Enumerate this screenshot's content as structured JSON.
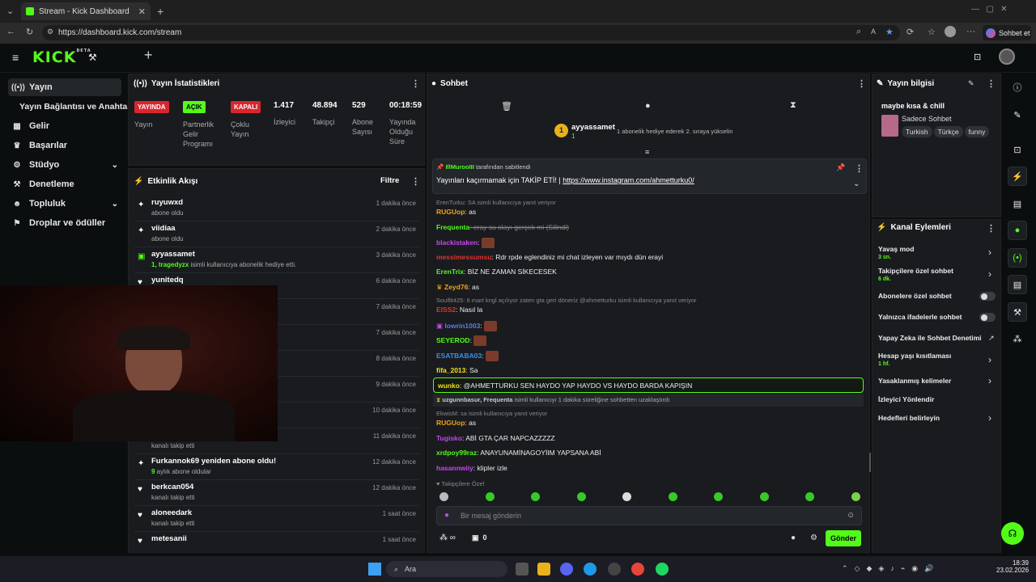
{
  "browser": {
    "tab_title": "Stream - Kick Dashboard",
    "url": "https://dashboard.kick.com/stream",
    "copilot_label": "Sohbet et"
  },
  "brand": {
    "logo": "KICK",
    "beta": "BETA",
    "accent": "#53fc18"
  },
  "sidebar": {
    "items": [
      {
        "label": "Yayın",
        "icon": "broadcast-icon"
      },
      {
        "label": "Yayın Bağlantısı ve Anahtarı",
        "icon": ""
      },
      {
        "label": "Gelir",
        "icon": "revenue-icon"
      },
      {
        "label": "Başarılar",
        "icon": "trophy-icon"
      },
      {
        "label": "Stüdyo",
        "icon": "studio-icon"
      },
      {
        "label": "Denetleme",
        "icon": "moderation-icon"
      },
      {
        "label": "Topluluk",
        "icon": "community-icon"
      },
      {
        "label": "Droplar ve ödüller",
        "icon": "drops-icon"
      }
    ]
  },
  "stats": {
    "title": "Yayın İstatistikleri",
    "badges": [
      {
        "label": "YAYINDA",
        "color": "#d9262c",
        "caption": "Yayın"
      },
      {
        "label": "AÇIK",
        "color": "#53fc18",
        "caption": "Partnerlik Gelir Programı"
      },
      {
        "label": "KAPALI",
        "color": "#d9262c",
        "caption": "Çoklu Yayın"
      }
    ],
    "numbers": [
      {
        "value": "1.417",
        "label": "İzleyici"
      },
      {
        "value": "48.894",
        "label": "Takipçi"
      },
      {
        "value": "529",
        "label": "Abone Sayısı"
      },
      {
        "value": "00:18:59",
        "label": "Yayında Olduğu Süre"
      }
    ]
  },
  "activity": {
    "title": "Etkinlik Akışı",
    "filter": "Filtre",
    "rows": [
      {
        "name": "ruyuwxd",
        "desc": "abone oldu",
        "time": "1 dakika önce",
        "icon": "sparkle-icon"
      },
      {
        "name": "viidiaa",
        "desc": "abone oldu",
        "time": "2 dakika önce",
        "icon": "sparkle-icon"
      },
      {
        "name": "ayyassamet",
        "desc_hl": "1, tragedyzx",
        "desc": " isimli kullanıcıya abonelik hediye etti.",
        "time": "3 dakika önce",
        "icon": "gift-icon"
      },
      {
        "name": "yunitedq",
        "desc": "",
        "time": "6 dakika önce",
        "icon": "heart-icon"
      },
      {
        "name": "",
        "desc": "",
        "time": "7 dakika önce",
        "icon": ""
      },
      {
        "name": "",
        "desc": "",
        "time": "7 dakika önce",
        "icon": ""
      },
      {
        "name": "",
        "desc": "",
        "time": "8 dakika önce",
        "icon": ""
      },
      {
        "name": "",
        "desc": "",
        "time": "9 dakika önce",
        "icon": ""
      },
      {
        "name": "",
        "desc": "",
        "time": "10 dakika önce",
        "icon": ""
      },
      {
        "name": "",
        "desc": "kanalı takip etti",
        "time": "11 dakika önce",
        "icon": ""
      },
      {
        "name": "Furkannok69 yeniden abone oldu!",
        "desc_hl": "9",
        "desc": " aylık abone oldular",
        "time": "12 dakika önce",
        "icon": "sparkle-icon"
      },
      {
        "name": "berkcan054",
        "desc": "kanalı takip etti",
        "time": "12 dakika önce",
        "icon": "heart-icon"
      },
      {
        "name": "aloneedark",
        "desc": "kanalı takip etti",
        "time": "1 saat önce",
        "icon": "heart-icon"
      },
      {
        "name": "metesanii",
        "desc": "",
        "time": "1 saat önce",
        "icon": "heart-icon"
      }
    ]
  },
  "chat": {
    "title": "Sohbet",
    "top_gifter": {
      "rank": "1",
      "name": "ayyassamet",
      "count": "1",
      "note": "1 abonelik hediye ederek 2. sıraya yükselin"
    },
    "pinned": {
      "by_user": "IllMurooIII",
      "by_text": "tarafından sabitlendi",
      "text": "Yayınları kaçırmamak için TAKİP ETİ! |",
      "link": "https://www.instagram.com/ahmetturku0/"
    },
    "messages": [
      {
        "type": "reply",
        "text": "ErenTurku: SA isimli kullanıcıya yanıt veriyor"
      },
      {
        "type": "msg",
        "user": "RUGUop",
        "color": "#f0a31b",
        "text": ": as"
      },
      {
        "type": "msg",
        "user": "Frequenta",
        "color": "#53fc18",
        "text": ": eray su olayı gerçek mi (Silindi)",
        "deleted": true
      },
      {
        "type": "msg",
        "user": "blackistaken",
        "color": "#c848e8",
        "text": ":",
        "emote": true
      },
      {
        "type": "msg",
        "user": "messimessumsu",
        "color": "#e0332f",
        "text": ": Rdr rpde eglendiniz mi chat izleyen var mıydı dün erayi"
      },
      {
        "type": "msg",
        "user": "ErenTrix",
        "color": "#53fc18",
        "text": ": BİZ NE ZAMAN SİKECESEK"
      },
      {
        "type": "msg",
        "user": "Zeyd76",
        "color": "#f0a31b",
        "text": ": as"
      },
      {
        "type": "reply",
        "text": "Soulfit425: 6 mart kngl açılıyor zaten gta geri döneriz @ahmetturku isimli kullanıcıya yanıt veriyor"
      },
      {
        "type": "msg",
        "user": "EISS2",
        "color": "#e0332f",
        "text": ": Nasıl la"
      },
      {
        "type": "msg",
        "user": "lowrin1003",
        "color": "#5b7cf0",
        "text": ":",
        "emote": true
      },
      {
        "type": "msg",
        "user": "SEYEROD",
        "color": "#53fc18",
        "text": ":",
        "emote": true
      },
      {
        "type": "msg",
        "user": "ESATBABA03",
        "color": "#3a8fe8",
        "text": ":",
        "emote": true
      },
      {
        "type": "msg",
        "user": "fifa_2013",
        "color": "#f0e01b",
        "text": ": Sa"
      },
      {
        "type": "highlight",
        "user": "wunko",
        "color": "#f0e01b",
        "text": ": @AHMETTURKU SEN HAYDO YAP HAYDO VS HAYDO BARDA KAPIŞIN"
      },
      {
        "type": "timeout",
        "text1": "uzgunnbasur, Frequenta",
        "text2": " isimli kullanıcıyı 1 dakika süreliğine sohbetten uzaklaştırdı"
      },
      {
        "type": "reply",
        "text": "EkwisM: sa isimli kullanıcıya yanıt veriyor"
      },
      {
        "type": "msg",
        "user": "RUGUop",
        "color": "#f0a31b",
        "text": ": as"
      },
      {
        "type": "msg",
        "user": "Tugisko",
        "color": "#c848e8",
        "text": ": ABİ GTA ÇAR NAPCAZZZZZ"
      },
      {
        "type": "msg",
        "user": "xrdpoy99raz",
        "color": "#53fc18",
        "text": ": ANAYUNAMİNAGOYİIM YAPSANA ABİ"
      },
      {
        "type": "msg",
        "user": "hasannwiiy",
        "color": "#c848e8",
        "text": ": klipler izle"
      }
    ],
    "followers_only": "Takipçilere Özel",
    "input_placeholder": "Bir mesaj gönderin",
    "footer_count": "0",
    "send_label": "Gönder"
  },
  "stream_info": {
    "title": "Yayın bilgisi",
    "stream_title": "maybe kısa & chill",
    "category": "Sadece Sohbet",
    "tags": [
      "Turkish",
      "Türkçe",
      "funny"
    ]
  },
  "channel_actions": {
    "title": "Kanal Eylemleri",
    "items": [
      {
        "label": "Yavaş mod",
        "sub": "3 sn.",
        "control": "chevron"
      },
      {
        "label": "Takipçilere özel sohbet",
        "sub": "6 dk.",
        "control": "chevron"
      },
      {
        "label": "Abonelere özel sohbet",
        "sub": "",
        "control": "toggle"
      },
      {
        "label": "Yalnızca ifadelerle sohbet",
        "sub": "",
        "control": "toggle"
      },
      {
        "label": "Yapay Zeka ile Sohbet Denetimi",
        "sub": "",
        "control": "external"
      },
      {
        "label": "Hesap yaşı kısıtlaması",
        "sub": "1 hf.",
        "control": "chevron"
      },
      {
        "label": "Yasaklanmış kelimeler",
        "sub": "",
        "control": "chevron"
      },
      {
        "label": "İzleyici Yönlendir",
        "sub": "",
        "control": "none"
      },
      {
        "label": "Hedefleri belirleyin",
        "sub": "",
        "control": "chevron"
      }
    ]
  },
  "taskbar": {
    "search_label": "Ara",
    "time": "18:39",
    "date": "23.02.2026"
  }
}
